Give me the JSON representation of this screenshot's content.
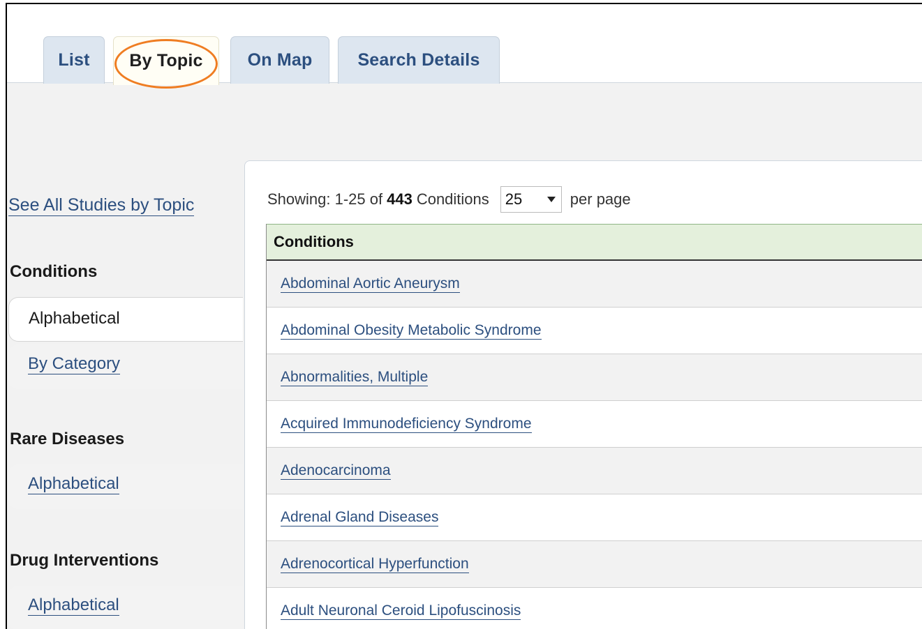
{
  "tabs": [
    {
      "label": "List",
      "active": false
    },
    {
      "label": "By Topic",
      "active": true
    },
    {
      "label": "On Map",
      "active": false
    },
    {
      "label": "Search Details",
      "active": false
    }
  ],
  "sidebar": {
    "see_all_label": "See All Studies by Topic",
    "sections": [
      {
        "heading": "Conditions",
        "items": [
          {
            "label": "Alphabetical",
            "selected": true
          },
          {
            "label": "By Category",
            "selected": false
          }
        ]
      },
      {
        "heading": "Rare Diseases",
        "items": [
          {
            "label": "Alphabetical",
            "selected": false
          }
        ]
      },
      {
        "heading": "Drug Interventions",
        "items": [
          {
            "label": "Alphabetical",
            "selected": false
          }
        ]
      }
    ]
  },
  "main": {
    "showing_prefix": "Showing: 1-25 of",
    "total_count": "443",
    "showing_suffix": "Conditions",
    "per_page_value": "25",
    "per_page_label": "per page",
    "table": {
      "header": "Conditions",
      "rows": [
        "Abdominal Aortic Aneurysm",
        "Abdominal Obesity Metabolic Syndrome",
        "Abnormalities, Multiple",
        "Acquired Immunodeficiency Syndrome",
        "Adenocarcinoma",
        "Adrenal Gland Diseases",
        "Adrenocortical Hyperfunction",
        "Adult Neuronal Ceroid Lipofuscinosis"
      ]
    }
  },
  "colors": {
    "link": "#2c4f7f",
    "highlight": "#ef7d22",
    "tab_bg": "#dde6f0",
    "header_bg": "#e4f0dc"
  }
}
